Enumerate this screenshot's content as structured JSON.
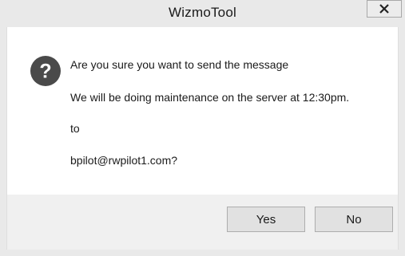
{
  "window": {
    "title": "WizmoTool",
    "close_icon": "close-x-icon"
  },
  "message": {
    "icon": "question-icon",
    "line1": "Are you sure you want to send the message",
    "line2": "We will be doing maintenance on the server at 12:30pm.",
    "line3": "to",
    "line4": "bpilot@rwpilot1.com?"
  },
  "buttons": {
    "yes_label": "Yes",
    "no_label": "No"
  },
  "colors": {
    "icon_fill": "#4a4a4a",
    "frame": "#e9e9e9",
    "button_bar": "#f0f0f0"
  }
}
